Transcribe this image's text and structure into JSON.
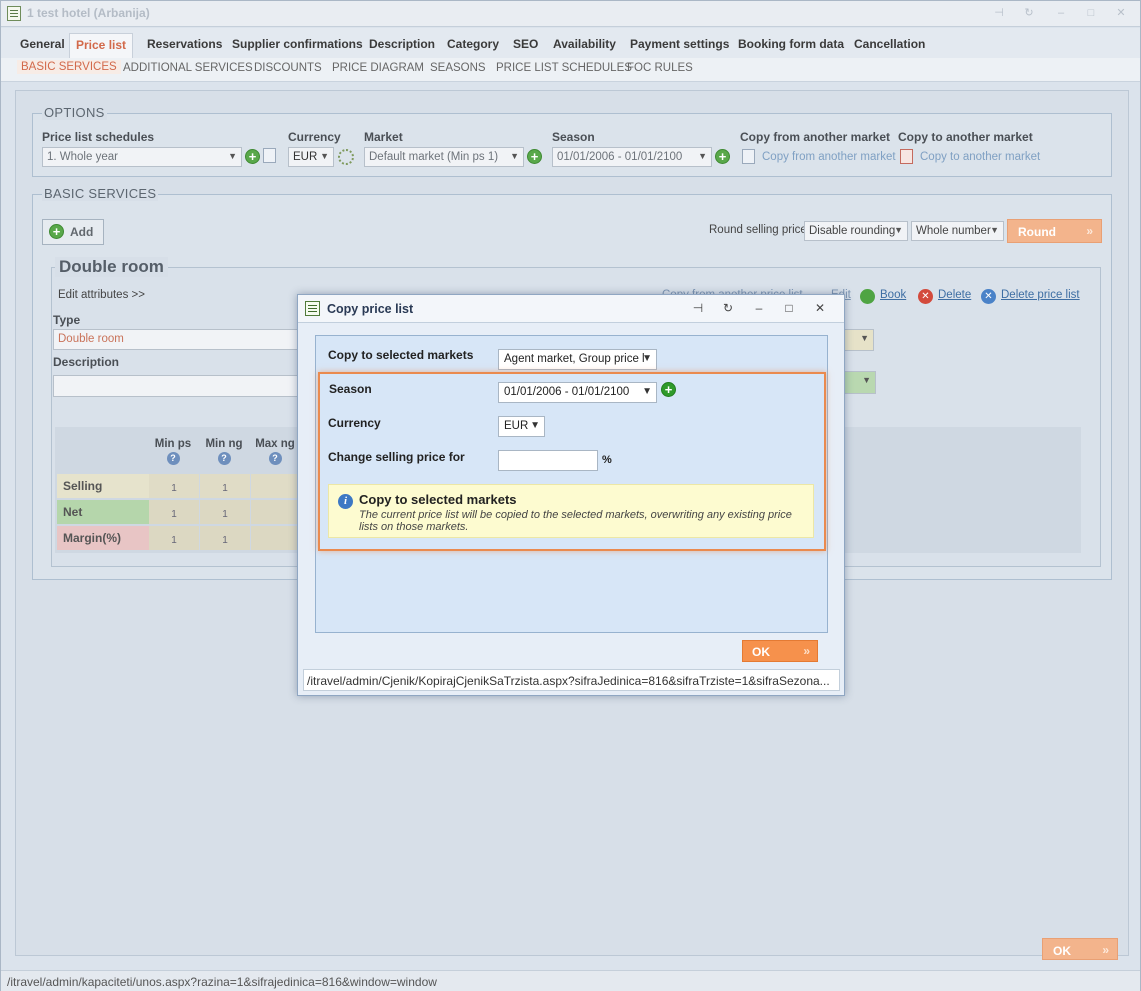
{
  "window": {
    "title": "1 test hotel (Arbanija)"
  },
  "tabs": [
    {
      "label": "General"
    },
    {
      "label": "Price list"
    },
    {
      "label": "Reservations"
    },
    {
      "label": "Supplier confirmations"
    },
    {
      "label": "Description"
    },
    {
      "label": "Category"
    },
    {
      "label": "SEO"
    },
    {
      "label": "Availability"
    },
    {
      "label": "Payment settings"
    },
    {
      "label": "Booking form data"
    },
    {
      "label": "Cancellation"
    }
  ],
  "active_tab": "Price list",
  "subtabs": [
    {
      "label": "BASIC SERVICES"
    },
    {
      "label": "ADDITIONAL SERVICES"
    },
    {
      "label": "DISCOUNTS"
    },
    {
      "label": "PRICE DIAGRAM"
    },
    {
      "label": "SEASONS"
    },
    {
      "label": "PRICE LIST SCHEDULES"
    },
    {
      "label": "FOC RULES"
    }
  ],
  "options": {
    "legend": "OPTIONS",
    "price_list_schedules_label": "Price list schedules",
    "price_list_schedules_value": "1. Whole year",
    "currency_label": "Currency",
    "currency_value": "EUR",
    "market_label": "Market",
    "market_value": "Default market (Min ps 1)",
    "season_label": "Season",
    "season_value": "01/01/2006 - 01/01/2100",
    "copy_from_label": "Copy from another market",
    "copy_from_link": "Copy from another market",
    "copy_to_label": "Copy to another market",
    "copy_to_link": "Copy to another market"
  },
  "basic_services": {
    "legend": "BASIC SERVICES",
    "add_label": "Add",
    "round_selling_label": "Round selling price",
    "rounding_value": "Disable rounding",
    "number_value": "Whole number",
    "round_button": "Round"
  },
  "room": {
    "title": "Double room",
    "edit_attributes": "Edit attributes >>",
    "copy_link": "Copy from another price list",
    "edit_link": "Edit",
    "book_link": "Book",
    "delete_link": "Delete",
    "delete_price_list_link": "Delete price list",
    "type_label": "Type",
    "type_value": "Double room",
    "description_label": "Description",
    "columns": [
      "Min ps",
      "Min ng",
      "Max ng"
    ],
    "rows": [
      {
        "label": "Selling",
        "values": [
          "1",
          "1"
        ]
      },
      {
        "label": "Net",
        "values": [
          "1",
          "1"
        ]
      },
      {
        "label": "Margin(%)",
        "values": [
          "1",
          "1"
        ]
      }
    ]
  },
  "footer": {
    "ok_button": "OK",
    "status_url": "/itravel/admin/kapaciteti/unos.aspx?razina=1&sifrajedinica=816&window=window"
  },
  "modal": {
    "title": "Copy price list",
    "copy_to_label": "Copy to selected markets",
    "copy_to_value": "Agent market, Group price l",
    "season_label": "Season",
    "season_value": "01/01/2006 - 01/01/2100",
    "currency_label": "Currency",
    "currency_value": "EUR",
    "change_label": "Change selling price for",
    "change_value": "",
    "percent": "%",
    "info_title": "Copy to selected markets",
    "info_text": "The current price list will be copied to the selected markets, overwriting any existing price lists on those markets.",
    "ok_button": "OK",
    "status_url": "/itravel/admin/Cjenik/KopirajCjenikSaTrzista.aspx?sifraJedinica=816&sifraTrziste=1&sifraSezona..."
  },
  "colors": {
    "accent_orange": "#f6914c",
    "active_tab": "#d2694a",
    "highlight_border": "#ea8a4e",
    "selling_row": "#e9e6cf",
    "net_row": "#b9dcb0",
    "margin_row": "#ecc7c7"
  }
}
